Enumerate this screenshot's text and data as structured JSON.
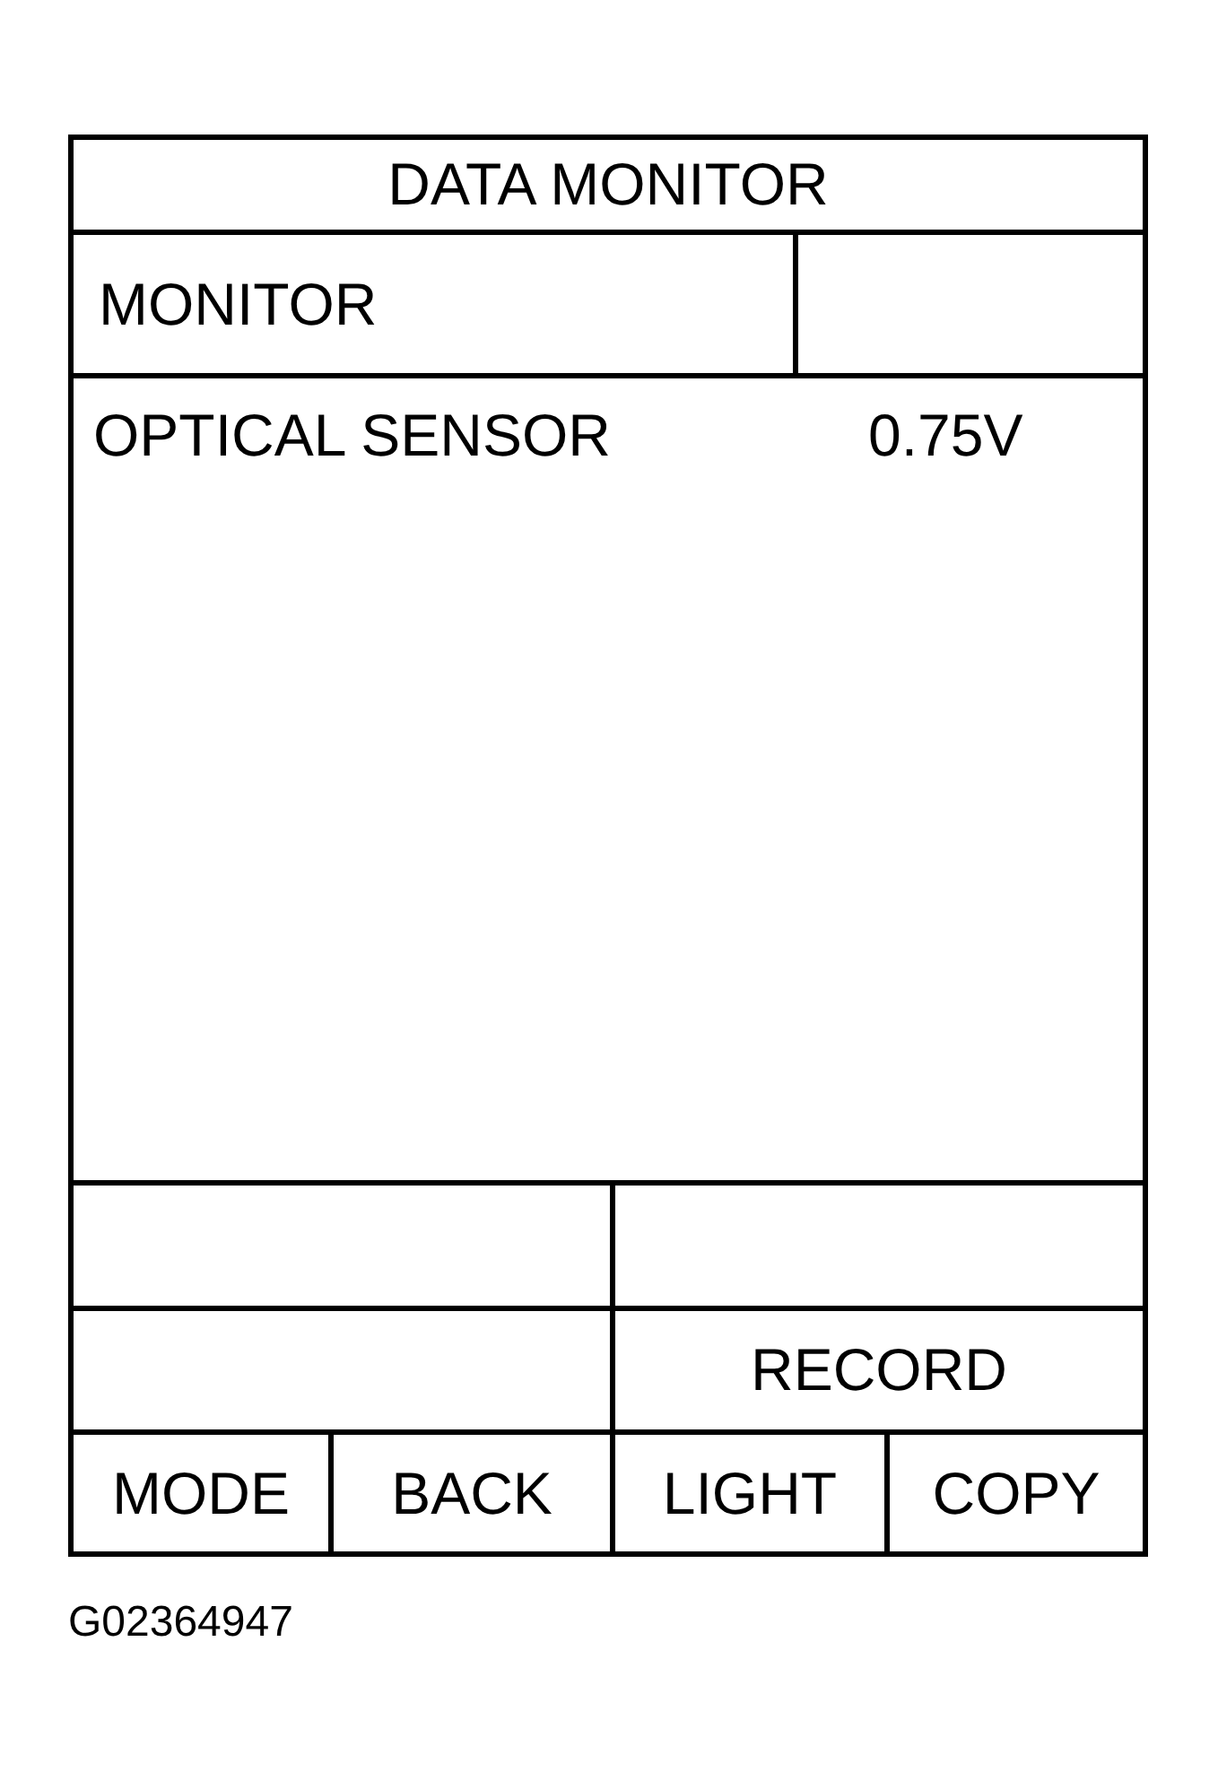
{
  "display": {
    "title": "DATA MONITOR",
    "header": {
      "label": "MONITOR"
    },
    "readings": [
      {
        "name": "OPTICAL SENSOR",
        "value": "0.75V"
      }
    ],
    "function_labels": [
      {
        "label": "RECORD"
      }
    ],
    "buttons": [
      "MODE",
      "BACK",
      "LIGHT",
      "COPY"
    ]
  },
  "figure_id": "G02364947"
}
